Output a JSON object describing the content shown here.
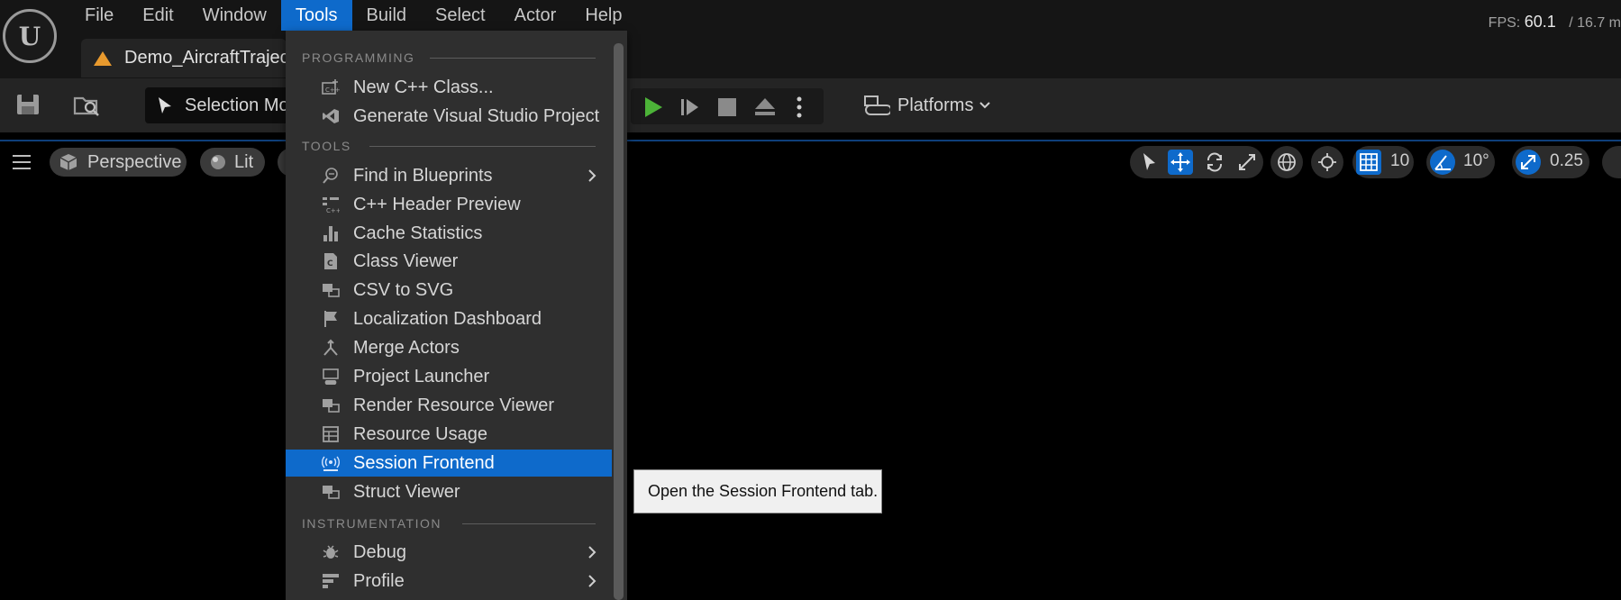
{
  "app": {
    "logo_text": "U"
  },
  "menubar": [
    {
      "label": "File"
    },
    {
      "label": "Edit"
    },
    {
      "label": "Window"
    },
    {
      "label": "Tools"
    },
    {
      "label": "Build"
    },
    {
      "label": "Select"
    },
    {
      "label": "Actor"
    },
    {
      "label": "Help"
    }
  ],
  "fps": {
    "label": "FPS:",
    "value": "60.1",
    "frame_time": "/ 16.7 m"
  },
  "document_tab": {
    "name": "Demo_AircraftTrajec"
  },
  "toolbar": {
    "selection_mode": "Selection Mo",
    "platforms": "Platforms"
  },
  "viewport": {
    "perspective": "Perspective",
    "lit": "Lit",
    "grid_snap": "10",
    "rotation_snap": "10°",
    "scale_snap": "0.25"
  },
  "tools_menu": {
    "sections": {
      "programming": "PROGRAMMING",
      "tools": "TOOLS",
      "instrumentation": "INSTRUMENTATION"
    },
    "items": [
      {
        "label": "New C++ Class...",
        "icon": "cpp-class-icon"
      },
      {
        "label": "Generate Visual Studio Project",
        "icon": "visual-studio-icon"
      },
      {
        "label": "Find in Blueprints",
        "icon": "find-blueprints-icon",
        "submenu": true
      },
      {
        "label": "C++ Header Preview",
        "icon": "header-preview-icon"
      },
      {
        "label": "Cache Statistics",
        "icon": "bar-chart-icon"
      },
      {
        "label": "Class Viewer",
        "icon": "class-viewer-icon"
      },
      {
        "label": "CSV to SVG",
        "icon": "csv-svg-icon"
      },
      {
        "label": "Localization Dashboard",
        "icon": "flag-icon"
      },
      {
        "label": "Merge Actors",
        "icon": "merge-icon"
      },
      {
        "label": "Project Launcher",
        "icon": "launcher-icon"
      },
      {
        "label": "Render Resource Viewer",
        "icon": "render-resource-icon"
      },
      {
        "label": "Resource Usage",
        "icon": "table-icon"
      },
      {
        "label": "Session Frontend",
        "icon": "broadcast-icon",
        "highlighted": true
      },
      {
        "label": "Struct Viewer",
        "icon": "struct-icon"
      },
      {
        "label": "Debug",
        "icon": "bug-icon",
        "submenu": true
      },
      {
        "label": "Profile",
        "icon": "profile-icon",
        "submenu": true
      }
    ]
  },
  "tooltip": {
    "text": "Open the Session Frontend tab."
  },
  "colors": {
    "accent": "#0e6acb",
    "menu_bg": "#2f2f2f",
    "play_green": "#4cb338"
  }
}
